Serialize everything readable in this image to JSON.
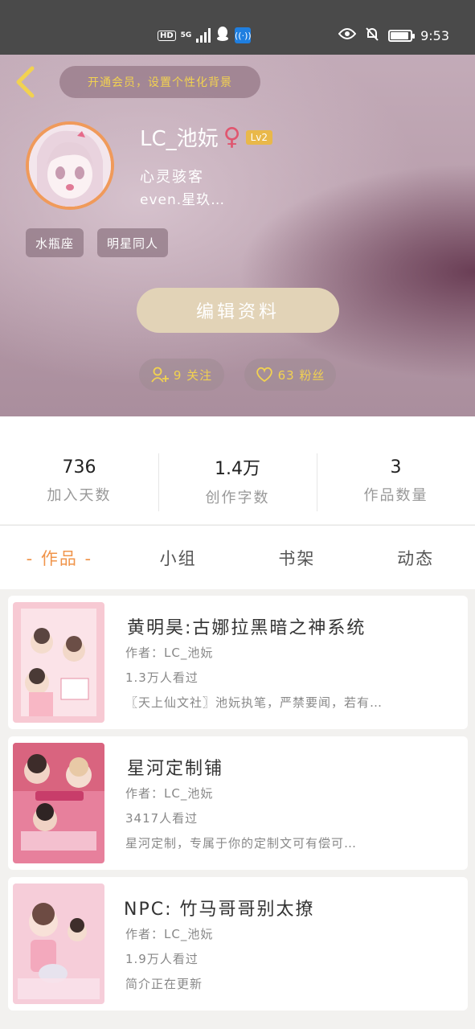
{
  "status_bar": {
    "hd": "HD",
    "network": "5G",
    "time": "9:53",
    "battery_level": 0.9
  },
  "header": {
    "vip_banner": "开通会员，设置个性化背景",
    "username": "LC_池妧",
    "gender_symbol": "♀",
    "level": "Lv2",
    "motto": "心灵骇客",
    "subname": "even.星玖…",
    "tags": [
      "水瓶座",
      "明星同人"
    ],
    "edit_label": "编辑资料",
    "following": "9 关注",
    "fans": "63 粉丝"
  },
  "stats": [
    {
      "value": "736",
      "label": "加入天数"
    },
    {
      "value": "1.4万",
      "label": "创作字数"
    },
    {
      "value": "3",
      "label": "作品数量"
    }
  ],
  "tabs": [
    "- 作品 -",
    "小组",
    "书架",
    "动态"
  ],
  "works": [
    {
      "title": "黄明昊:古娜拉黑暗之神系统",
      "author": "作者：LC_池妧",
      "views": "1.3万人看过",
      "desc": "〖天上仙文社〗池妧执笔，严禁要闻，若有…"
    },
    {
      "title": "星河定制铺",
      "author": "作者：LC_池妧",
      "views": "3417人看过",
      "desc": "星河定制，专属于你的定制文可有偿可…"
    },
    {
      "title": "NPC: 竹马哥哥别太撩",
      "author": "作者：LC_池妧",
      "views": "1.9万人看过",
      "desc": "简介正在更新"
    }
  ],
  "colors": {
    "accent": "#f0944a",
    "vip_text": "#f2d250",
    "avatar_ring": "#f09a5a",
    "edit_button": "#e2d3b7"
  }
}
